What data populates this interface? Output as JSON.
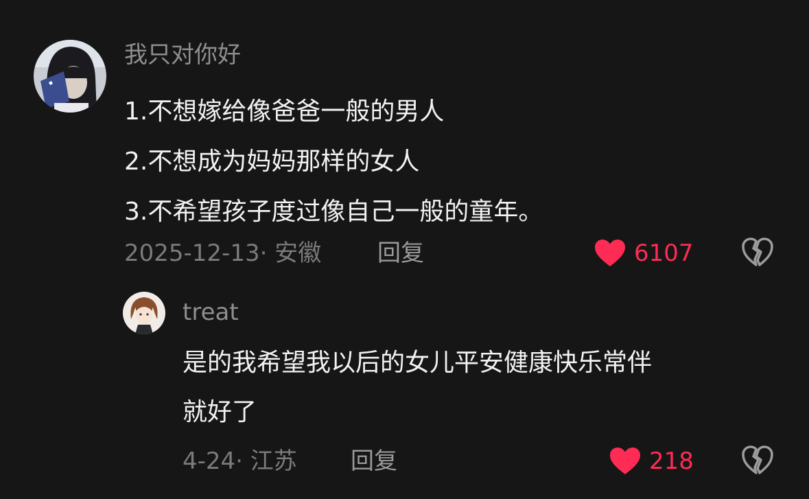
{
  "colors": {
    "background": "#161616",
    "like": "#fe2c55",
    "username": "#8f8f8f",
    "meta": "#7b7b7b",
    "text": "#f2f2f2"
  },
  "comments": [
    {
      "username": "我只对你好",
      "avatar_icon": "user-avatar-photo",
      "text_lines": [
        "1.不想嫁给像爸爸一般的男人",
        "2.不想成为妈妈那样的女人",
        "3.不希望孩子度过像自己一般的童年。"
      ],
      "meta": "2025-12-13· 安徽",
      "reply_label": "回复",
      "like_icon": "heart-filled-icon",
      "likes": "6107",
      "dislike_icon": "broken-heart-icon"
    },
    {
      "username": "treat",
      "avatar_icon": "user-avatar-illustration",
      "text_lines": [
        "是的我希望我以后的女儿平安健康快乐常伴",
        "就好了"
      ],
      "meta": "4-24· 江苏",
      "reply_label": "回复",
      "like_icon": "heart-filled-icon",
      "likes": "218",
      "dislike_icon": "broken-heart-icon"
    }
  ]
}
